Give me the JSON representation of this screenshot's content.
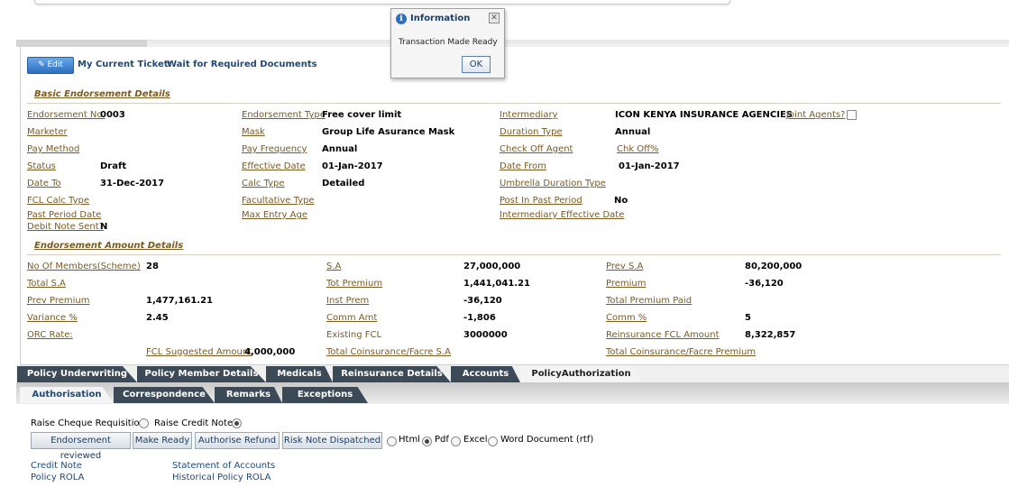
{
  "header": {
    "edit_label": "Edit",
    "ticket_label": "My Current Ticket:",
    "ticket_value": "Wait for Required Documents"
  },
  "dialog": {
    "title": "Information",
    "message": "Transaction Made Ready",
    "ok_label": "OK",
    "info_icon": "i",
    "close_icon": "✕"
  },
  "basic": {
    "title": "Basic Endorsement Details",
    "endorsement_no_label": "Endorsement No.",
    "endorsement_no": "0003",
    "marketer_label": "Marketer",
    "pay_method_label": "Pay Method",
    "status_label": "Status",
    "status": "Draft",
    "date_to_label": "Date To",
    "date_to": "31-Dec-2017",
    "fcl_calc_type_label": "FCL Calc Type",
    "past_period_date_label": "Past Period Date",
    "debit_note_sent_label": "Debit Note Sent?",
    "debit_note_sent": "N",
    "endorsement_type_label": "Endorsement Type",
    "endorsement_type": "Free cover limit",
    "mask_label": "Mask",
    "mask": "Group Life Asurance Mask",
    "pay_frequency_label": "Pay Frequency",
    "pay_frequency": "Annual",
    "effective_date_label": "Effective Date",
    "effective_date": "01-Jan-2017",
    "calc_type_label": "Calc Type",
    "calc_type": "Detailed",
    "facultative_type_label": "Facultative Type",
    "max_entry_age_label": "Max Entry Age",
    "intermediary_label": "Intermediary",
    "intermediary": "ICON KENYA INSURANCE AGENCIES",
    "joint_agents_label": "Joint Agents?",
    "duration_type_label": "Duration Type",
    "duration_type": "Annual",
    "check_off_agent_label": "Check Off Agent",
    "chk_off_label": "Chk Off%",
    "date_from_label": "Date From",
    "date_from": "01-Jan-2017",
    "umbrella_duration_label": "Umbrella Duration Type",
    "post_past_period_label": "Post In Past Period",
    "post_past_period": "No",
    "intermediary_eff_date_label": "Intermediary Effective Date"
  },
  "amount": {
    "title": "Endorsement Amount Details",
    "no_members_label": "No Of Members(Scheme)",
    "no_members": "28",
    "total_sa_label": "Total S.A",
    "prev_premium_label": "Prev Premium",
    "prev_premium": "1,477,161.21",
    "variance_label": "Variance %",
    "variance": "2.45",
    "orc_rate_label": "ORC Rate:",
    "fcl_suggested_label": "FCL Suggested Amount",
    "fcl_suggested": "4,000,000",
    "sa_label": "S.A",
    "sa": "27,000,000",
    "tot_premium_label": "Tot Premium",
    "tot_premium": "1,441,041.21",
    "inst_prem_label": "Inst Prem",
    "inst_prem": "-36,120",
    "comm_amt_label": "Comm Amt",
    "comm_amt": "-1,806",
    "existing_fcl_label": "Existing FCL",
    "existing_fcl": "3000000",
    "total_coins_sa_label": "Total Coinsurance/Facre S.A",
    "prev_sa_label": "Prev S.A",
    "prev_sa": "80,200,000",
    "premium_label": "Premium",
    "premium": "-36,120",
    "total_premium_paid_label": "Total Premium Paid",
    "comm_pct_label": "Comm %",
    "comm_pct": "5",
    "reins_fcl_label": "Reinsurance FCL Amount",
    "reins_fcl": "8,322,857",
    "total_coins_prem_label": "Total Coinsurance/Facre Premium"
  },
  "tabs": [
    {
      "label": "Policy Underwriting"
    },
    {
      "label": "Policy Member Details"
    },
    {
      "label": "Medicals"
    },
    {
      "label": "Reinsurance Details"
    },
    {
      "label": "Accounts"
    },
    {
      "label": "PolicyAuthorization"
    }
  ],
  "subtabs": [
    {
      "label": "Authorisation"
    },
    {
      "label": "Correspondence"
    },
    {
      "label": "Remarks"
    },
    {
      "label": "Exceptions"
    }
  ],
  "auth": {
    "raise_cheque_label": "Raise Cheque Requisition",
    "raise_credit_label": "Raise Credit Note",
    "btn_endorsement_reviewed": "Endorsement reviewed",
    "btn_make_ready": "Make Ready",
    "btn_authorise_refund": "Authorise Refund",
    "btn_risk_note": "Risk Note Dispatched",
    "fmt_html": "Html",
    "fmt_pdf": "Pdf",
    "fmt_excel": "Excel",
    "fmt_word": "Word Document (rtf)",
    "link_credit_note": "Credit Note",
    "link_policy_rola": "Policy ROLA",
    "link_statement": "Statement of Accounts",
    "link_historical": "Historical Policy ROLA"
  }
}
